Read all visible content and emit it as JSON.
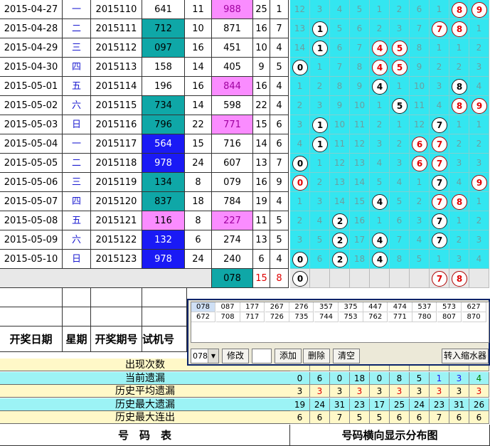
{
  "colors": {
    "cyan": "#33e6f0",
    "teal": "#0fa7a7",
    "pink": "#fa8cff",
    "blue": "#1a1af5",
    "yellow": "#fff8c8",
    "green_row": "#9cf3a0",
    "red": "#e00000"
  },
  "rows": [
    {
      "date": "2015-04-27",
      "weekday": "一",
      "issue": "2015110",
      "trial": "641",
      "trial_bg": "white",
      "sum1": "11",
      "win": "988",
      "win_bg": "pink",
      "sum2": "25",
      "span": "1",
      "dist": [
        "12",
        "3",
        "4",
        "5",
        "1",
        "2",
        "6",
        "1",
        "8",
        "9"
      ],
      "balls": [
        8,
        9
      ],
      "red": [
        8,
        9
      ]
    },
    {
      "date": "2015-04-28",
      "weekday": "二",
      "issue": "2015111",
      "trial": "712",
      "trial_bg": "teal",
      "sum1": "10",
      "win": "871",
      "win_bg": "white",
      "sum2": "16",
      "span": "7",
      "dist": [
        "13",
        "1",
        "5",
        "6",
        "2",
        "3",
        "7",
        "7",
        "8",
        "1"
      ],
      "balls": [
        1,
        7,
        8
      ],
      "red": [
        7,
        8
      ]
    },
    {
      "date": "2015-04-29",
      "weekday": "三",
      "issue": "2015112",
      "trial": "097",
      "trial_bg": "teal",
      "sum1": "16",
      "win": "451",
      "win_bg": "white",
      "sum2": "10",
      "span": "4",
      "dist": [
        "14",
        "1",
        "6",
        "7",
        "4",
        "5",
        "8",
        "1",
        "1",
        "2"
      ],
      "balls": [
        1,
        4,
        5
      ],
      "red": [
        4,
        5
      ]
    },
    {
      "date": "2015-04-30",
      "weekday": "四",
      "issue": "2015113",
      "trial": "158",
      "trial_bg": "white",
      "sum1": "14",
      "win": "405",
      "win_bg": "white",
      "sum2": "9",
      "span": "5",
      "dist": [
        "0",
        "1",
        "7",
        "8",
        "4",
        "5",
        "9",
        "2",
        "2",
        "3"
      ],
      "balls": [
        0,
        4,
        5
      ],
      "red": [
        4,
        5
      ]
    },
    {
      "date": "2015-05-01",
      "weekday": "五",
      "issue": "2015114",
      "trial": "196",
      "trial_bg": "white",
      "sum1": "16",
      "win": "844",
      "win_bg": "pink",
      "sum2": "16",
      "span": "4",
      "dist": [
        "1",
        "2",
        "8",
        "9",
        "4",
        "1",
        "10",
        "3",
        "8",
        "4"
      ],
      "balls": [
        4,
        8
      ],
      "red": []
    },
    {
      "date": "2015-05-02",
      "weekday": "六",
      "issue": "2015115",
      "trial": "734",
      "trial_bg": "teal",
      "sum1": "14",
      "win": "598",
      "win_bg": "white",
      "sum2": "22",
      "span": "4",
      "dist": [
        "2",
        "3",
        "9",
        "10",
        "1",
        "5",
        "11",
        "4",
        "8",
        "9"
      ],
      "balls": [
        5,
        8,
        9
      ],
      "red": [
        8,
        9
      ]
    },
    {
      "date": "2015-05-03",
      "weekday": "日",
      "issue": "2015116",
      "trial": "796",
      "trial_bg": "teal",
      "sum1": "22",
      "win": "771",
      "win_bg": "pink",
      "sum2": "15",
      "span": "6",
      "dist": [
        "3",
        "1",
        "10",
        "11",
        "2",
        "1",
        "12",
        "7",
        "1",
        "1"
      ],
      "balls": [
        1,
        7
      ],
      "red": []
    },
    {
      "date": "2015-05-04",
      "weekday": "一",
      "issue": "2015117",
      "trial": "564",
      "trial_bg": "blue",
      "sum1": "15",
      "win": "716",
      "win_bg": "white",
      "sum2": "14",
      "span": "6",
      "dist": [
        "4",
        "1",
        "11",
        "12",
        "3",
        "2",
        "6",
        "7",
        "2",
        "2"
      ],
      "balls": [
        1,
        6,
        7
      ],
      "red": [
        6,
        7
      ]
    },
    {
      "date": "2015-05-05",
      "weekday": "二",
      "issue": "2015118",
      "trial": "978",
      "trial_bg": "blue",
      "sum1": "24",
      "win": "607",
      "win_bg": "white",
      "sum2": "13",
      "span": "7",
      "dist": [
        "0",
        "1",
        "12",
        "13",
        "4",
        "3",
        "6",
        "7",
        "3",
        "3"
      ],
      "balls": [
        0,
        6,
        7
      ],
      "red": [
        6,
        7
      ]
    },
    {
      "date": "2015-05-06",
      "weekday": "三",
      "issue": "2015119",
      "trial": "134",
      "trial_bg": "teal",
      "sum1": "8",
      "win": "079",
      "win_bg": "white",
      "sum2": "16",
      "span": "9",
      "dist": [
        "0",
        "2",
        "13",
        "14",
        "5",
        "4",
        "1",
        "7",
        "4",
        "9"
      ],
      "balls": [
        0,
        7,
        9
      ],
      "red": [
        0,
        9
      ]
    },
    {
      "date": "2015-05-07",
      "weekday": "四",
      "issue": "2015120",
      "trial": "837",
      "trial_bg": "teal",
      "sum1": "18",
      "win": "784",
      "win_bg": "white",
      "sum2": "19",
      "span": "4",
      "dist": [
        "1",
        "3",
        "14",
        "15",
        "4",
        "5",
        "2",
        "7",
        "8",
        "1"
      ],
      "balls": [
        4,
        7,
        8
      ],
      "red": [
        7,
        8
      ]
    },
    {
      "date": "2015-05-08",
      "weekday": "五",
      "issue": "2015121",
      "trial": "116",
      "trial_bg": "pink",
      "sum1": "8",
      "win": "227",
      "win_bg": "pink",
      "sum2": "11",
      "span": "5",
      "dist": [
        "2",
        "4",
        "2",
        "16",
        "1",
        "6",
        "3",
        "7",
        "1",
        "2"
      ],
      "balls": [
        2,
        7
      ],
      "red": []
    },
    {
      "date": "2015-05-09",
      "weekday": "六",
      "issue": "2015122",
      "trial": "132",
      "trial_bg": "blue",
      "sum1": "6",
      "win": "274",
      "win_bg": "white",
      "sum2": "13",
      "span": "5",
      "dist": [
        "3",
        "5",
        "2",
        "17",
        "4",
        "7",
        "4",
        "7",
        "2",
        "3"
      ],
      "balls": [
        2,
        4,
        7
      ],
      "red": []
    },
    {
      "date": "2015-05-10",
      "weekday": "日",
      "issue": "2015123",
      "trial": "978",
      "trial_bg": "blue",
      "sum1": "24",
      "win": "240",
      "win_bg": "white",
      "sum2": "6",
      "span": "4",
      "dist": [
        "0",
        "6",
        "2",
        "18",
        "4",
        "8",
        "5",
        "1",
        "3",
        "4"
      ],
      "balls": [
        0,
        2,
        4
      ],
      "red": []
    }
  ],
  "forecast": {
    "win": "078",
    "sum": "15",
    "span": "8",
    "balls": [
      0,
      7,
      8
    ],
    "red": [
      7,
      8
    ]
  },
  "header": {
    "date": "开奖日期",
    "weekday": "星期",
    "issue": "开奖期号",
    "trial": "试机号"
  },
  "popup": {
    "numbers_row1": [
      "078",
      "087",
      "177",
      "267",
      "276",
      "357",
      "375",
      "447",
      "474",
      "537",
      "573",
      "627"
    ],
    "numbers_row2": [
      "672",
      "708",
      "717",
      "726",
      "735",
      "744",
      "753",
      "762",
      "771",
      "780",
      "807",
      "870"
    ],
    "selected": "078",
    "btn_modify": "修改",
    "btn_add": "添加",
    "btn_delete": "删除",
    "btn_clear": "清空",
    "btn_shrink": "转入缩水器"
  },
  "stats": [
    {
      "label": "出现次数",
      "values": []
    },
    {
      "label": "当前遗漏",
      "values": [
        "0",
        "6",
        "0",
        "18",
        "0",
        "8",
        "5",
        "1",
        "3",
        "4"
      ]
    },
    {
      "label": "历史平均遗漏",
      "values": [
        "3",
        "3",
        "3",
        "3",
        "3",
        "3",
        "3",
        "3",
        "3",
        "3"
      ]
    },
    {
      "label": "历史最大遗漏",
      "values": [
        "19",
        "24",
        "31",
        "23",
        "17",
        "25",
        "24",
        "23",
        "31",
        "26"
      ]
    },
    {
      "label": "历史最大连出",
      "values": [
        "6",
        "6",
        "7",
        "5",
        "5",
        "6",
        "6",
        "7",
        "6",
        "6"
      ]
    }
  ],
  "footer": {
    "left": "号　码　表",
    "right": "号码横向显示分布图"
  }
}
